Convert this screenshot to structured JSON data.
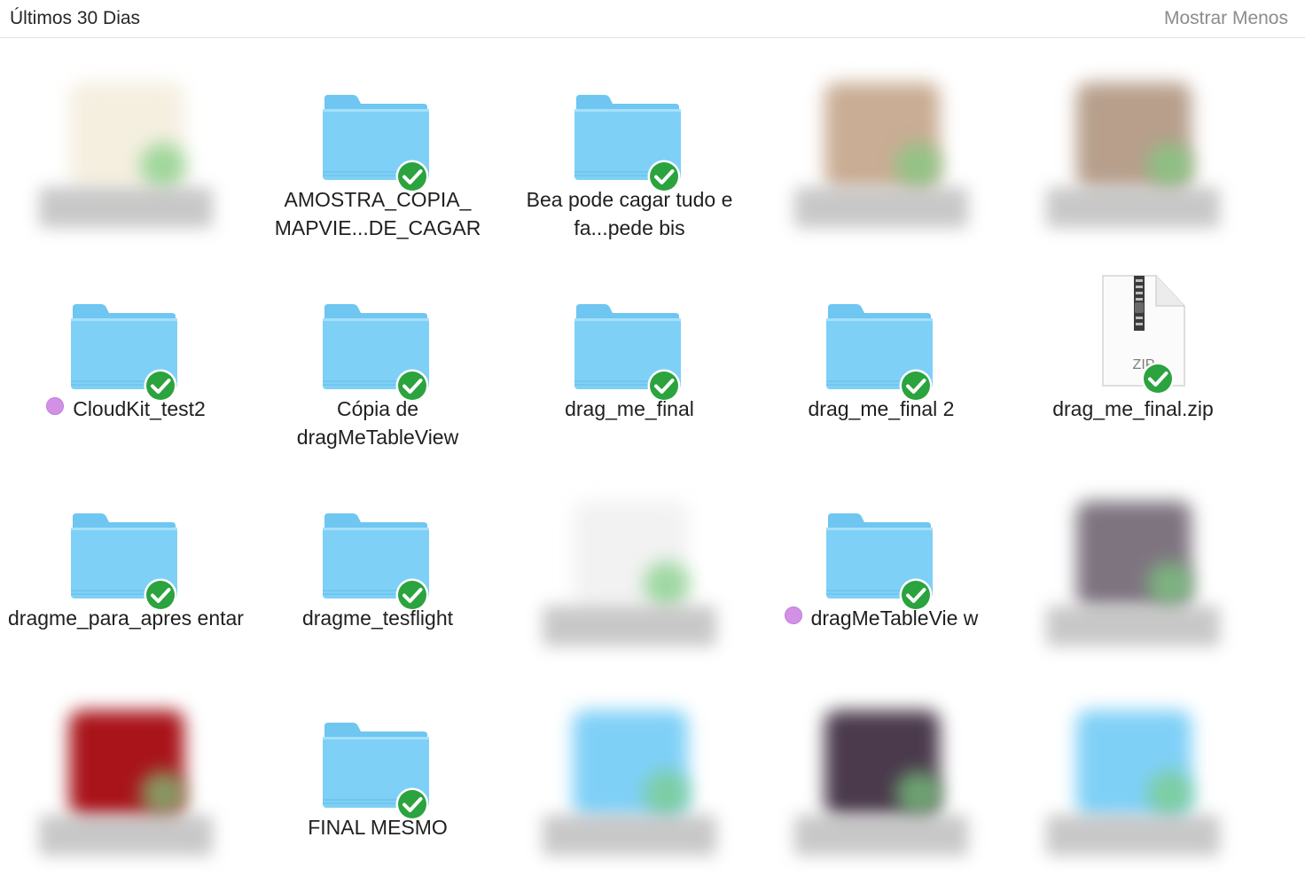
{
  "header": {
    "title": "Últimos 30 Dias",
    "toggle_label": "Mostrar Menos"
  },
  "colors": {
    "folder_body": "#7fd0f7",
    "folder_tab": "#6ec6f1",
    "sync_badge": "#2ba33e",
    "purple_tag": "#d291e6"
  },
  "items": [
    {
      "label": "",
      "kind": "blurred-document",
      "icon": "document-thumbnail"
    },
    {
      "label": "AMOSTRA_COPIA_ MAPVIE...DE_CAGAR",
      "kind": "folder",
      "icon": "folder-icon"
    },
    {
      "label": "Bea pode cagar tudo e fa...pede bis",
      "kind": "folder",
      "icon": "folder-icon"
    },
    {
      "label": "",
      "kind": "blurred-image",
      "icon": "image-thumbnail"
    },
    {
      "label": "",
      "kind": "blurred-image",
      "icon": "image-thumbnail"
    },
    {
      "label": "CloudKit_test2",
      "kind": "folder",
      "tag": "purple",
      "icon": "folder-icon"
    },
    {
      "label": "Cópia de dragMeTableView",
      "kind": "folder",
      "icon": "folder-icon"
    },
    {
      "label": "drag_me_final",
      "kind": "folder",
      "icon": "folder-icon"
    },
    {
      "label": "drag_me_final 2",
      "kind": "folder",
      "icon": "folder-icon"
    },
    {
      "label": "drag_me_final.zip",
      "kind": "zip",
      "icon": "zip-archive-icon",
      "badge_text": "ZIP"
    },
    {
      "label": "dragme_para_apres entar",
      "kind": "folder",
      "icon": "folder-icon"
    },
    {
      "label": "dragme_tesflight",
      "kind": "folder",
      "icon": "folder-icon"
    },
    {
      "label": "",
      "kind": "blurred-document",
      "icon": "document-thumbnail"
    },
    {
      "label": "dragMeTableVie w",
      "kind": "folder",
      "tag": "purple",
      "icon": "folder-icon"
    },
    {
      "label": "",
      "kind": "blurred-image",
      "icon": "image-thumbnail"
    },
    {
      "label": "",
      "kind": "blurred-image",
      "icon": "image-thumbnail"
    },
    {
      "label": "FINAL MESMO",
      "kind": "folder",
      "icon": "folder-icon"
    },
    {
      "label": "",
      "kind": "blurred-folder",
      "icon": "folder-icon"
    },
    {
      "label": "",
      "kind": "blurred-image",
      "icon": "image-thumbnail"
    },
    {
      "label": "",
      "kind": "blurred-folder",
      "icon": "folder-icon"
    }
  ]
}
